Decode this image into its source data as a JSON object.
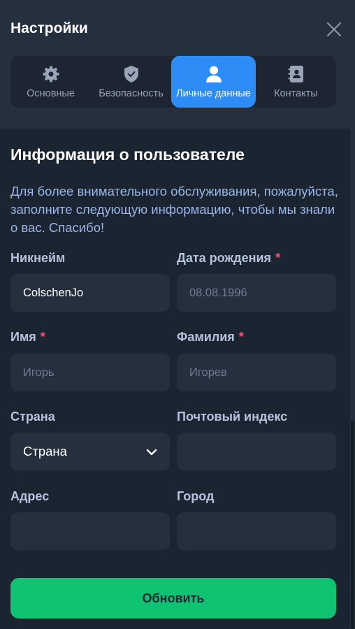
{
  "header": {
    "title": "Настройки",
    "close_icon": "close-icon"
  },
  "tabs": [
    {
      "label": "Основные",
      "icon": "gear-icon",
      "active": false
    },
    {
      "label": "Безопасность",
      "icon": "shield-check-icon",
      "active": false
    },
    {
      "label": "Личные данные",
      "icon": "user-icon",
      "active": true
    },
    {
      "label": "Контакты",
      "icon": "contacts-book-icon",
      "active": false
    }
  ],
  "section": {
    "title": "Информация о пользователе",
    "intro": "Для более внимательного обслуживания, пожалуйста, заполните следующую информацию, чтобы мы знали о вас. Спасибо!"
  },
  "form": {
    "nickname": {
      "label": "Никнейм",
      "value": "ColschenJo",
      "required": false
    },
    "birthdate": {
      "label": "Дата рождения",
      "placeholder": "08.08.1996",
      "required": true
    },
    "first_name": {
      "label": "Имя",
      "placeholder": "Игорь",
      "required": true
    },
    "last_name": {
      "label": "Фамилия",
      "placeholder": "Игорев",
      "required": true
    },
    "country": {
      "label": "Страна",
      "selected": "Страна",
      "icon": "chevron-down-icon"
    },
    "postal_code": {
      "label": "Почтовый индекс",
      "value": ""
    },
    "address": {
      "label": "Адрес",
      "value": ""
    },
    "city": {
      "label": "Город",
      "value": ""
    },
    "required_mark": "*"
  },
  "actions": {
    "submit_label": "Обновить"
  },
  "colors": {
    "accent": "#2d8cf6",
    "submit": "#10c373",
    "required": "#ff4d6d"
  }
}
